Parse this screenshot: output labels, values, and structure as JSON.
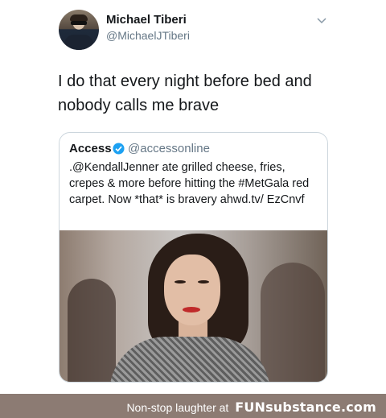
{
  "tweet": {
    "author_name": "Michael Tiberi",
    "author_handle": "@MichaelJTiberi",
    "text": "I do that every night before bed and nobody calls me brave",
    "menu_icon": "chevron-down-icon"
  },
  "quoted_tweet": {
    "author_name": "Access",
    "verified_icon": "verified-badge-icon",
    "author_handle": "@accessonline",
    "text": ".@KendallJenner ate grilled cheese, fries, crepes & more before hitting the #MetGala red carpet. Now *that* is bravery ahwd.tv/ EzCnvf"
  },
  "footer": {
    "text": "Non-stop laughter at",
    "brand": "FUNsubstance.com"
  },
  "colors": {
    "accent": "#1da1f2",
    "secondary_text": "#657786",
    "footer_bg": "#8c7b73"
  }
}
